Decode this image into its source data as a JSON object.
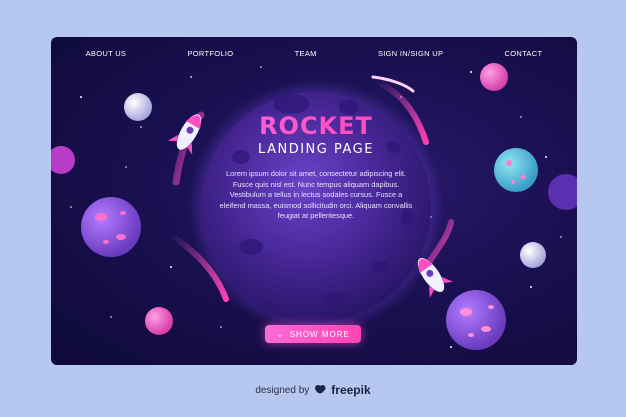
{
  "nav": {
    "items": [
      "ABOUT US",
      "PORTFOLIO",
      "TEAM",
      "SIGN IN/SIGN UP",
      "CONTACT"
    ]
  },
  "hero": {
    "title": "ROCKET",
    "subtitle": "LANDING PAGE",
    "body": "Lorem ipsum dolor sit amet, consectetur adipiscing elit. Fusce quis nisl est. Nunc tempus aliquam dapibus. Vestibulum a tellus in lectus sodales cursus. Fusce a eleifend massa, euismod sollicitudin orci. Aliquam convallis feugiat at pellentesque."
  },
  "cta": {
    "label": "SHOW MORE",
    "icon": "chevron-down-icon"
  },
  "footer": {
    "prefix": "designed by",
    "brand": "freepik",
    "icon": "freepik-logo-icon"
  },
  "colors": {
    "background": "#b6c8ef",
    "space": "#1a1052",
    "accent": "#ff4fc3",
    "planet": "#4b2a9a"
  }
}
